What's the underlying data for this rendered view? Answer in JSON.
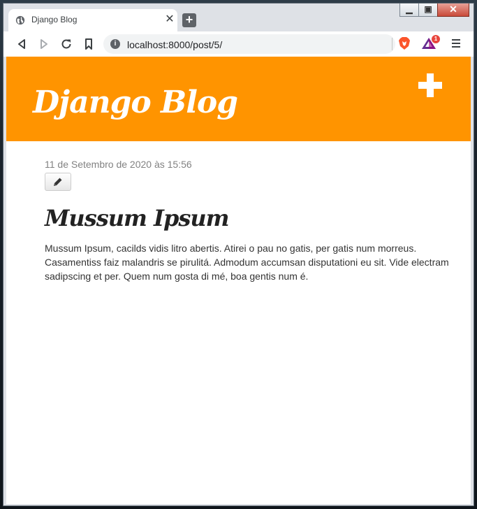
{
  "browser": {
    "tab_title": "Django Blog",
    "url": "localhost:8000/post/5/",
    "rewards_badge": "1",
    "icons": {
      "favicon": "globe-icon",
      "back": "back-icon",
      "forward": "forward-icon",
      "reload": "reload-icon",
      "bookmark": "bookmark-icon",
      "info": "info-icon",
      "brave": "brave-lion-icon",
      "rewards": "brave-rewards-icon",
      "menu": "hamburger-menu-icon"
    }
  },
  "page": {
    "site_title": "Django Blog",
    "header_color": "#ff9400",
    "add_icon": "plus-icon",
    "post": {
      "date": "11 de Setembro de 2020 às 15:56",
      "edit_icon": "pencil-icon",
      "title": "Mussum Ipsum",
      "body": "Mussum Ipsum, cacilds vidis litro abertis. Atirei o pau no gatis, per gatis num morreus. Casamentiss faiz malandris se pirulitá. Admodum accumsan disputationi eu sit. Vide electram sadipscing et per. Quem num gosta di mé, boa gentis num é."
    }
  }
}
